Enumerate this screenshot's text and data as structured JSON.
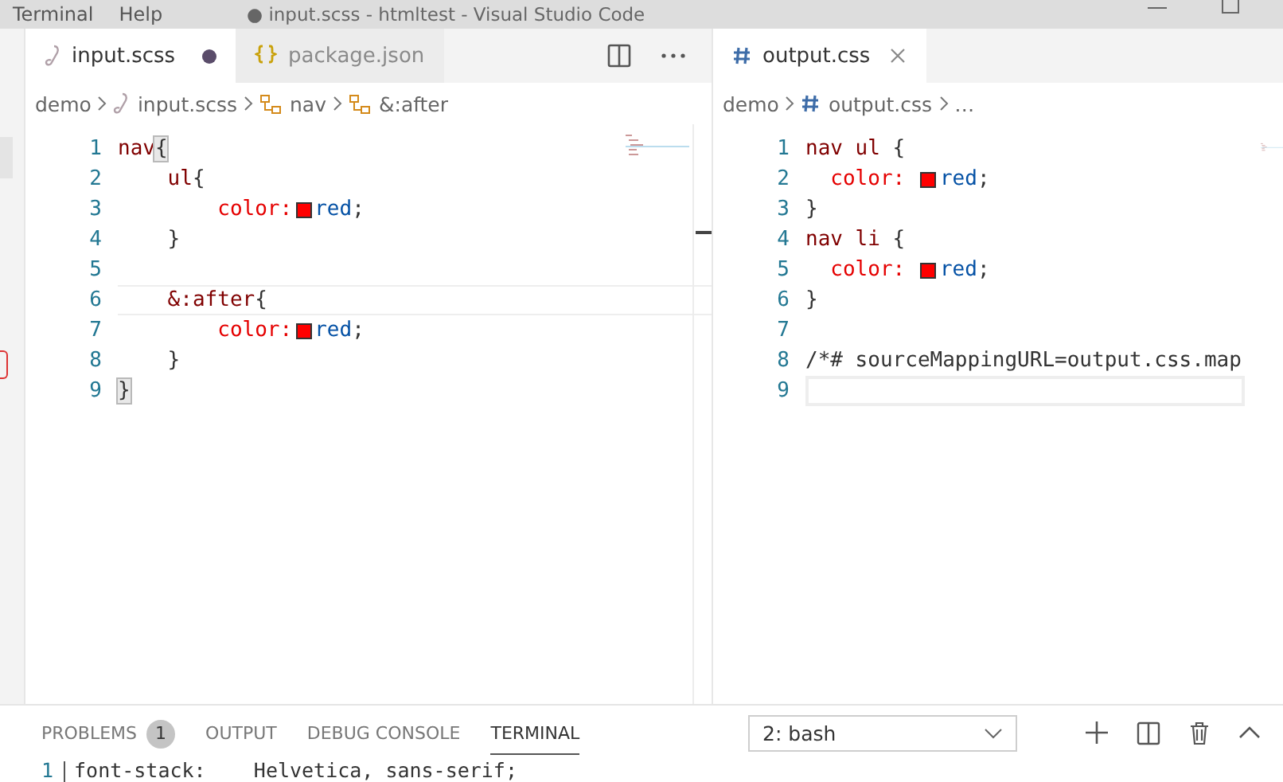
{
  "menu": {
    "items": [
      "Terminal",
      "Help"
    ],
    "title": "● input.scss - htmltest - Visual Studio Code"
  },
  "editors": [
    {
      "tabs": [
        {
          "label": "input.scss",
          "kind": "scss",
          "selected": true,
          "dirty": true
        },
        {
          "label": "package.json",
          "kind": "json",
          "selected": false,
          "dirty": false
        }
      ],
      "actions": true,
      "breadcrumbs": [
        {
          "kind": "folder",
          "text": "demo"
        },
        {
          "kind": "scss",
          "text": "input.scss"
        },
        {
          "kind": "symbol",
          "text": "nav"
        },
        {
          "kind": "symbol",
          "text": "&:after"
        }
      ],
      "lines": [
        {
          "number": "1",
          "current": false,
          "tokens": [
            {
              "kind": "tag",
              "text": "nav"
            },
            {
              "kind": "punct",
              "text": "{",
              "matched": true
            }
          ]
        },
        {
          "number": "2",
          "current": false,
          "tokens": [
            {
              "kind": "tag",
              "text": "    ul"
            },
            {
              "kind": "punct",
              "text": "{",
              "matched": false
            }
          ]
        },
        {
          "number": "3",
          "current": false,
          "tokens": [
            {
              "kind": "prop",
              "text": "        color:"
            },
            {
              "kind": "swatch",
              "color": "#ff0000"
            },
            {
              "kind": "value",
              "text": "red"
            },
            {
              "kind": "punct",
              "text": ";",
              "matched": false
            }
          ]
        },
        {
          "number": "4",
          "current": false,
          "tokens": [
            {
              "kind": "punct",
              "text": "    }",
              "matched": false
            }
          ]
        },
        {
          "number": "5",
          "current": false
        },
        {
          "number": "6",
          "current": true,
          "tokens": [
            {
              "kind": "tag",
              "text": "    &:after"
            },
            {
              "kind": "punct",
              "text": "{",
              "matched": false
            }
          ]
        },
        {
          "number": "7",
          "current": false,
          "tokens": [
            {
              "kind": "prop",
              "text": "        color:"
            },
            {
              "kind": "swatch",
              "color": "#ff0000"
            },
            {
              "kind": "value",
              "text": "red"
            },
            {
              "kind": "punct",
              "text": ";",
              "matched": false
            }
          ]
        },
        {
          "number": "8",
          "current": false,
          "tokens": [
            {
              "kind": "punct",
              "text": "    }",
              "matched": false
            }
          ]
        },
        {
          "number": "9",
          "current": false,
          "tokens": [
            {
              "kind": "punct",
              "text": "}",
              "matched": true
            }
          ]
        }
      ]
    },
    {
      "tabs": [
        {
          "label": "output.css",
          "kind": "css",
          "selected": true,
          "dirty": false
        }
      ],
      "actions": false,
      "breadcrumbs": [
        {
          "kind": "folder",
          "text": "demo"
        },
        {
          "kind": "css",
          "text": "output.css"
        },
        {
          "kind": "more",
          "text": "…"
        }
      ],
      "lines": [
        {
          "number": "1",
          "current": false,
          "tokens": [
            {
              "kind": "tag",
              "text": "nav ul"
            },
            {
              "kind": "punct",
              "text": " {",
              "matched": false
            }
          ]
        },
        {
          "number": "2",
          "current": false,
          "tokens": [
            {
              "kind": "prop",
              "text": "  color: "
            },
            {
              "kind": "swatch",
              "color": "#ff0000"
            },
            {
              "kind": "value",
              "text": "red"
            },
            {
              "kind": "punct",
              "text": ";",
              "matched": false
            }
          ]
        },
        {
          "number": "3",
          "current": false,
          "tokens": [
            {
              "kind": "punct",
              "text": "}",
              "matched": false
            }
          ]
        },
        {
          "number": "4",
          "current": false,
          "tokens": [
            {
              "kind": "tag",
              "text": "nav li"
            },
            {
              "kind": "punct",
              "text": " {",
              "matched": false
            }
          ]
        },
        {
          "number": "5",
          "current": false,
          "tokens": [
            {
              "kind": "prop",
              "text": "  color: "
            },
            {
              "kind": "swatch",
              "color": "#ff0000"
            },
            {
              "kind": "value",
              "text": "red"
            },
            {
              "kind": "punct",
              "text": ";",
              "matched": false
            }
          ]
        },
        {
          "number": "6",
          "current": false,
          "tokens": [
            {
              "kind": "punct",
              "text": "}",
              "matched": false
            }
          ]
        },
        {
          "number": "7",
          "current": false
        },
        {
          "number": "8",
          "current": false,
          "tokens": [
            {
              "kind": "plain",
              "text": "/*# sourceMappingURL=output.css.map"
            }
          ]
        },
        {
          "number": "9",
          "current": true
        }
      ]
    }
  ],
  "panel": {
    "tabs": [
      {
        "label": "PROBLEMS",
        "badge": "1",
        "selected": false
      },
      {
        "label": "OUTPUT",
        "selected": false
      },
      {
        "label": "DEBUG CONSOLE",
        "selected": false
      },
      {
        "label": "TERMINAL",
        "selected": true
      }
    ],
    "dropdown": "2: bash",
    "terminal": [
      {
        "number": "1",
        "text": "font-stack:    Helvetica, sans-serif;"
      }
    ]
  }
}
